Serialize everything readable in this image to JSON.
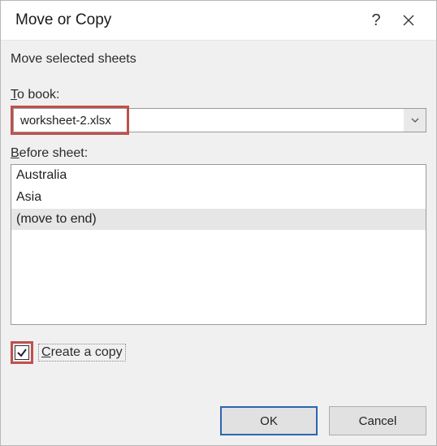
{
  "titlebar": {
    "title": "Move or Copy"
  },
  "body": {
    "instruction": "Move selected sheets",
    "to_book_label": "To book:",
    "to_book_value": "worksheet-2.xlsx",
    "before_sheet_label": "Before sheet:",
    "sheets": [
      {
        "label": "Australia",
        "selected": false
      },
      {
        "label": "Asia",
        "selected": false
      },
      {
        "label": "(move to end)",
        "selected": true
      }
    ],
    "create_copy_label_pre": "C",
    "create_copy_label_rest": "reate a copy",
    "create_copy_checked": true
  },
  "buttons": {
    "ok": "OK",
    "cancel": "Cancel"
  }
}
